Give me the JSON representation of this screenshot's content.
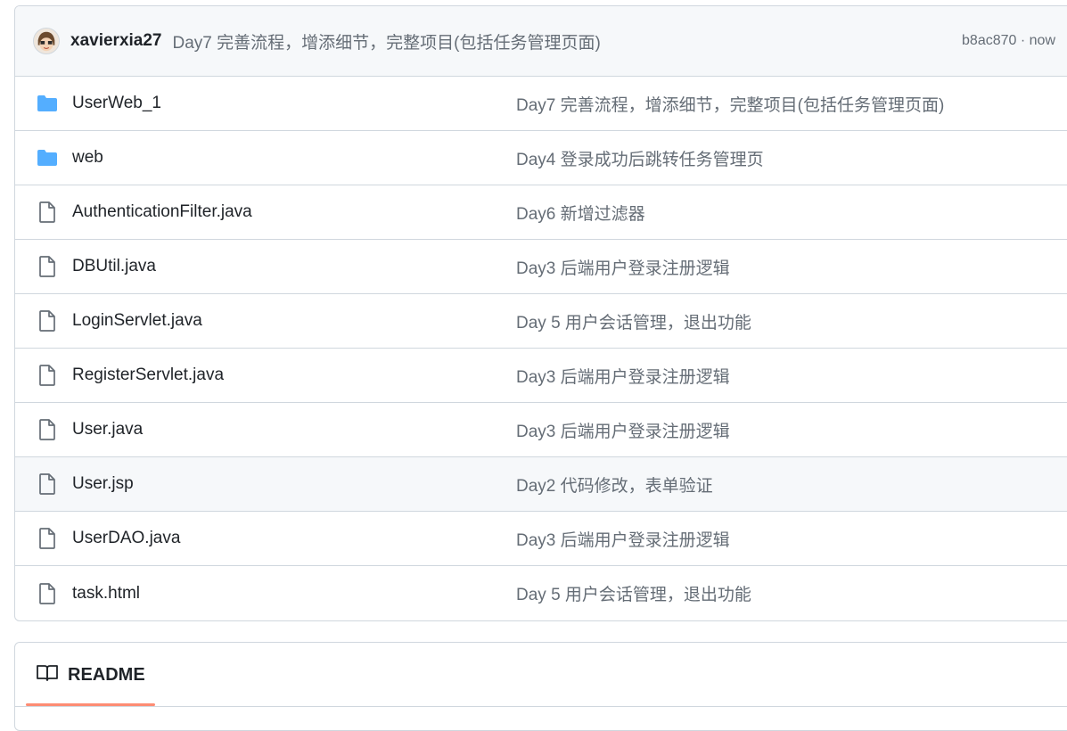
{
  "commit": {
    "author": "xavierxia27",
    "message": "Day7 完善流程，增添细节，完整项目(包括任务管理页面)",
    "meta": "b8ac870 · now"
  },
  "colors": {
    "folder": "#54aeff",
    "file": "#656d76",
    "readme_tab_underline": "#fd8c73"
  },
  "files": [
    {
      "type": "folder",
      "icon": "folder-icon",
      "name": "UserWeb_1",
      "message": "Day7 完善流程，增添细节，完整项目(包括任务管理页面)"
    },
    {
      "type": "folder",
      "icon": "folder-icon",
      "name": "web",
      "message": "Day4 登录成功后跳转任务管理页"
    },
    {
      "type": "file",
      "icon": "file-icon",
      "name": "AuthenticationFilter.java",
      "message": "Day6 新增过滤器"
    },
    {
      "type": "file",
      "icon": "file-icon",
      "name": "DBUtil.java",
      "message": "Day3 后端用户登录注册逻辑"
    },
    {
      "type": "file",
      "icon": "file-icon",
      "name": "LoginServlet.java",
      "message": "Day 5 用户会话管理，退出功能"
    },
    {
      "type": "file",
      "icon": "file-icon",
      "name": "RegisterServlet.java",
      "message": "Day3 后端用户登录注册逻辑"
    },
    {
      "type": "file",
      "icon": "file-icon",
      "name": "User.java",
      "message": "Day3 后端用户登录注册逻辑"
    },
    {
      "type": "file",
      "icon": "file-icon",
      "name": "User.jsp",
      "message": "Day2 代码修改，表单验证"
    },
    {
      "type": "file",
      "icon": "file-icon",
      "name": "UserDAO.java",
      "message": "Day3 后端用户登录注册逻辑"
    },
    {
      "type": "file",
      "icon": "file-icon",
      "name": "task.html",
      "message": "Day 5 用户会话管理，退出功能"
    }
  ],
  "readme": {
    "label": "README",
    "icon": "book-icon"
  }
}
